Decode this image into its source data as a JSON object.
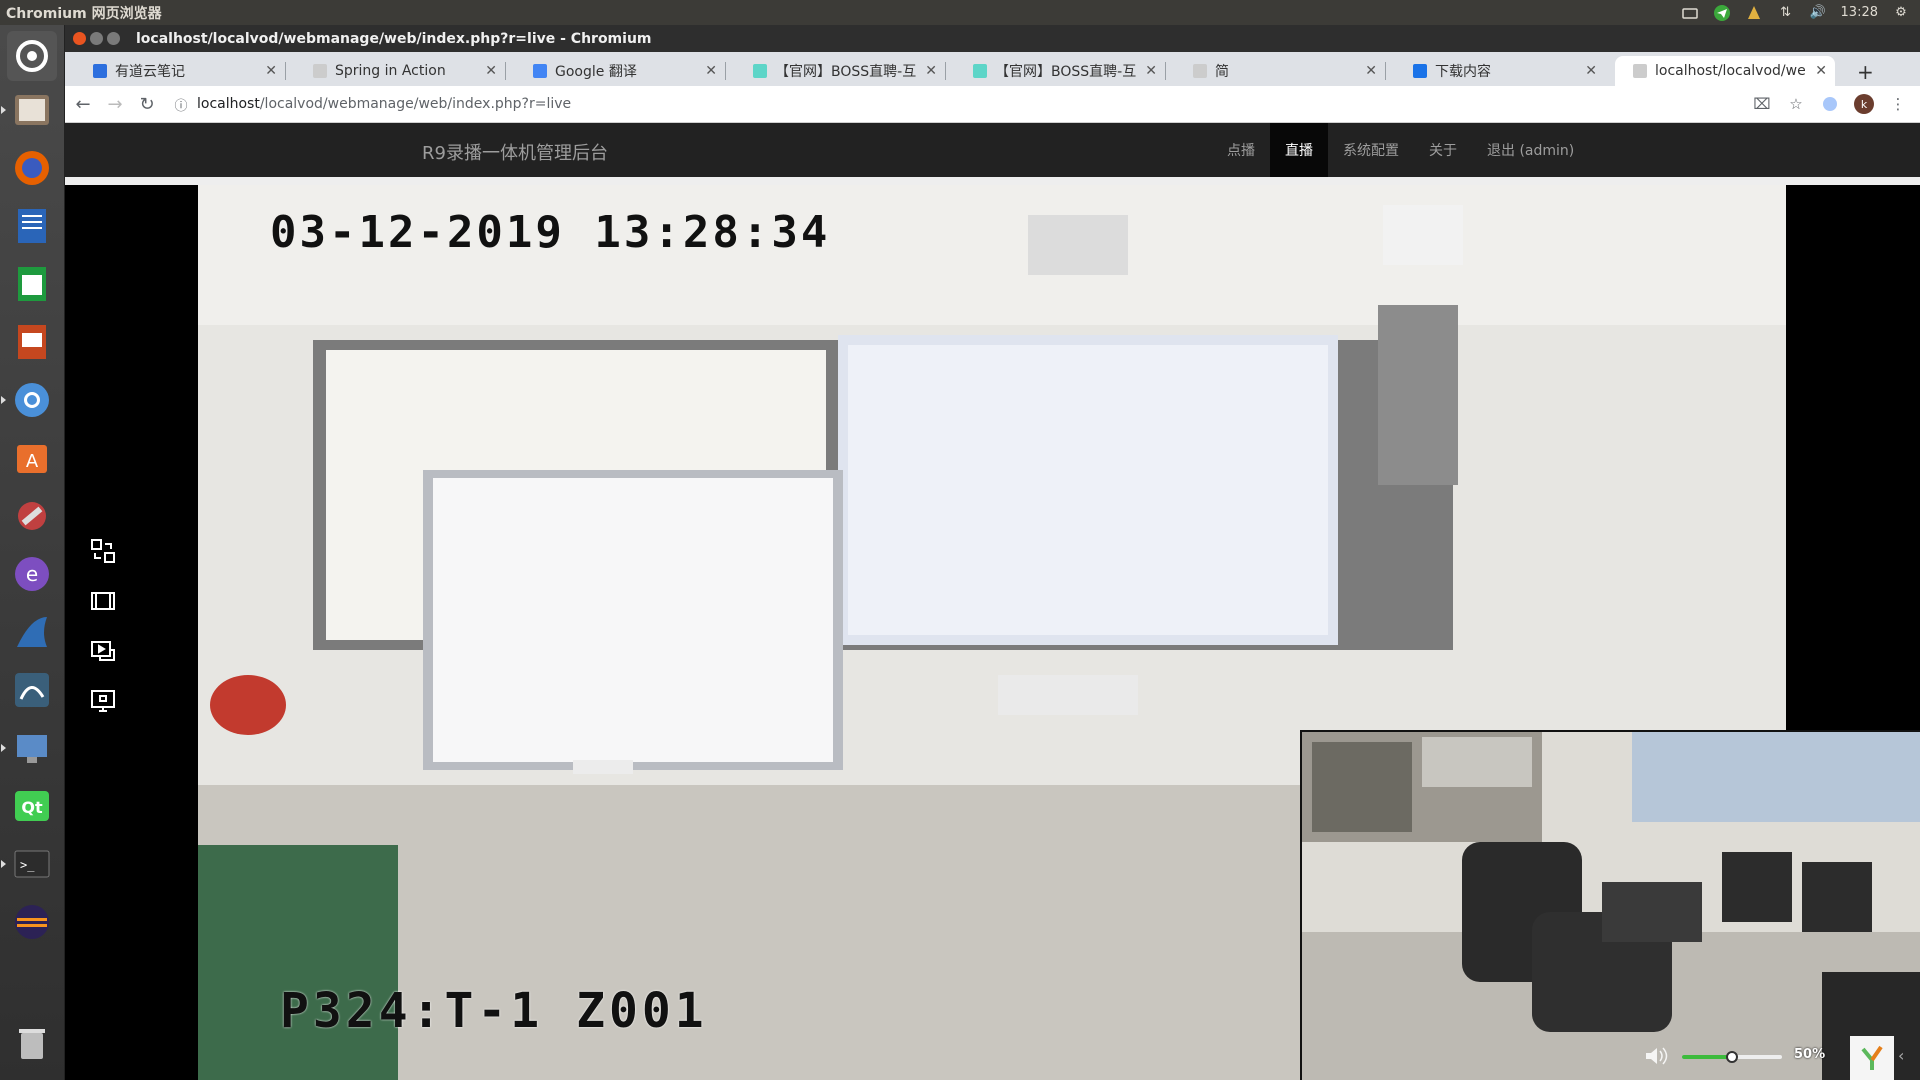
{
  "panel": {
    "app_name": "Chromium 网页浏览器",
    "clock": "13:28"
  },
  "window": {
    "title": "localhost/localvod/webmanage/web/index.php?r=live - Chromium"
  },
  "tabs": [
    {
      "label": "有道云笔记",
      "favicon_color": "#2d6fde"
    },
    {
      "label": "Spring in Action",
      "favicon_color": "#cccccc"
    },
    {
      "label": "Google 翻译",
      "favicon_color": "#4285f4"
    },
    {
      "label": "【官网】BOSS直聘-互",
      "favicon_color": "#5dd5c8"
    },
    {
      "label": "【官网】BOSS直聘-互",
      "favicon_color": "#5dd5c8"
    },
    {
      "label": "简",
      "favicon_color": "#cccccc"
    },
    {
      "label": "下载内容",
      "favicon_color": "#1a73e8"
    },
    {
      "label": "localhost/localvod/we",
      "favicon_color": "#cccccc"
    }
  ],
  "address": {
    "host": "localhost",
    "path": "/localvod/webmanage/web/index.php?r=live"
  },
  "toolbar": {
    "profile_initial": "k"
  },
  "app": {
    "brand": "R9录播一体机管理后台",
    "menu": [
      {
        "label": "点播",
        "active": false
      },
      {
        "label": "直播",
        "active": true
      },
      {
        "label": "系统配置",
        "active": false
      },
      {
        "label": "关于",
        "active": false
      },
      {
        "label": "退出 (admin)",
        "active": false
      }
    ]
  },
  "player": {
    "osd_timestamp": "03-12-2019 13:28:34",
    "osd_camera": "P324:T-1  Z001",
    "volume_level": 0.5,
    "volume_label": "50%",
    "tools": [
      "layout-switch-icon",
      "film-icon",
      "play-screen-icon",
      "monitor-icon"
    ]
  }
}
